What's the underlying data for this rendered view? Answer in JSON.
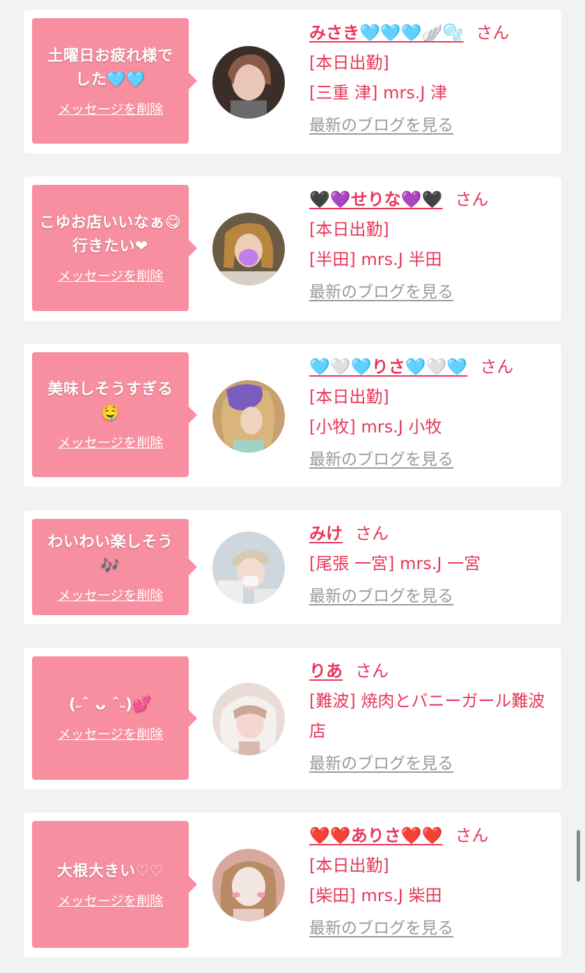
{
  "colors": {
    "background": "#f2f2f2",
    "card": "#ffffff",
    "bubble": "#f78fa0",
    "accent": "#e6385a",
    "muted_link": "#9a9a9a"
  },
  "messages": [
    {
      "text": "土曜日お疲れ様でした🩵🩵",
      "delete_label": "メッセージを削除",
      "name": "みさき🩵🩵🩵🪽🫧",
      "honorific": "さん",
      "lines": [
        "[本日出勤]",
        "[三重 津] mrs.J 津"
      ],
      "blog_label": "最新のブログを見る"
    },
    {
      "text": "こゆお店いいなぁ😋行きたい❤",
      "delete_label": "メッセージを削除",
      "name": "🖤💜せりな💜🖤",
      "honorific": "さん",
      "lines": [
        "[本日出勤]",
        "[半田] mrs.J 半田"
      ],
      "blog_label": "最新のブログを見る"
    },
    {
      "text": "美味しそうすぎる🤤",
      "delete_label": "メッセージを削除",
      "name": "🩵🤍🩵りさ🩵🤍🩵",
      "honorific": "さん",
      "lines": [
        "[本日出勤]",
        "[小牧] mrs.J 小牧"
      ],
      "blog_label": "最新のブログを見る"
    },
    {
      "text": "わいわい楽しそう🎶",
      "delete_label": "メッセージを削除",
      "name": "みけ",
      "honorific": "さん",
      "lines": [
        "[尾張 一宮] mrs.J 一宮"
      ],
      "blog_label": "最新のブログを見る"
    },
    {
      "text": "(˶ˆ ᴗ ˆ˵)💕",
      "delete_label": "メッセージを削除",
      "name": "りあ",
      "honorific": "さん",
      "lines": [
        "[難波] 焼肉とバニーガール難波店"
      ],
      "blog_label": "最新のブログを見る"
    },
    {
      "text": "大根大きい♡♡",
      "delete_label": "メッセージを削除",
      "name": "❤️❤️ありさ❤️❤️",
      "honorific": "さん",
      "lines": [
        "[本日出勤]",
        "[柴田] mrs.J 柴田"
      ],
      "blog_label": "最新のブログを見る"
    }
  ]
}
